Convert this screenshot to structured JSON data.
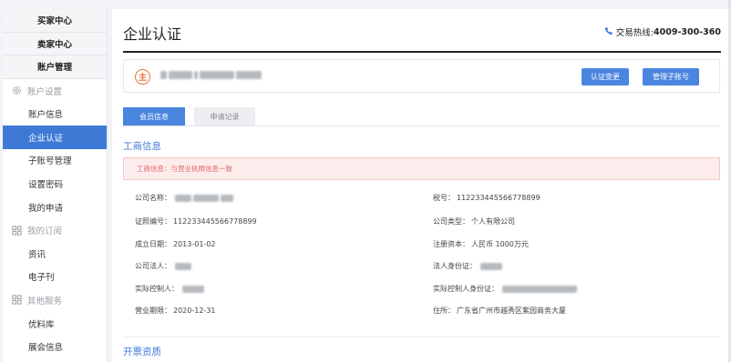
{
  "sidebar": {
    "heads": [
      "买家中心",
      "卖家中心",
      "账户管理"
    ],
    "groups": [
      {
        "label": "账户设置",
        "icon": "gear-icon",
        "items": [
          {
            "label": "账户信息",
            "active": false
          },
          {
            "label": "企业认证",
            "active": true
          },
          {
            "label": "子账号管理",
            "active": false
          },
          {
            "label": "设置密码",
            "active": false
          },
          {
            "label": "我的申请",
            "active": false
          }
        ]
      },
      {
        "label": "我的订阅",
        "icon": "grid-icon",
        "items": [
          {
            "label": "资讯",
            "active": false
          },
          {
            "label": "电子刊",
            "active": false
          }
        ]
      },
      {
        "label": "其他服务",
        "icon": "grid-icon",
        "items": [
          {
            "label": "优料库",
            "active": false
          },
          {
            "label": "展会信息",
            "active": false
          }
        ]
      }
    ]
  },
  "header": {
    "title": "企业认证",
    "hotline_label": "交易热线:",
    "hotline_number": "4009-300-360"
  },
  "company": {
    "badge": "主",
    "btn_change": "认证变更",
    "btn_manage": "管理子账号"
  },
  "tabs": [
    "会员信息",
    "申请记录"
  ],
  "business": {
    "section_title": "工商信息",
    "alert": "工商信息：与营业执照信息一致",
    "fields": {
      "company_name_label": "公司名称：",
      "tax_label": "税号：",
      "tax_value": "112233445566778899",
      "license_label": "证照编号：",
      "license_value": "112233445566778899",
      "type_label": "公司类型：",
      "type_value": "个人有限公司",
      "founded_label": "成立日期：",
      "founded_value": "2013-01-02",
      "capital_label": "注册资本：",
      "capital_value": "人民币 1000万元",
      "legal_label": "公司法人：",
      "legal_id_label": "法人身份证：",
      "controller_label": "实际控制人：",
      "controller_id_label": "实际控制人身份证：",
      "term_label": "营业期限：",
      "term_value": "2020-12-31",
      "address_label": "住所：",
      "address_value": "广东省广州市越秀区紫园商务大厦"
    }
  },
  "invoice": {
    "section_title": "开票资质"
  },
  "colors": {
    "accent": "#3f79d6",
    "button": "#4a85e0",
    "badge": "#e8733a",
    "alert_bg": "#fdecec",
    "alert_text": "#e06666"
  }
}
